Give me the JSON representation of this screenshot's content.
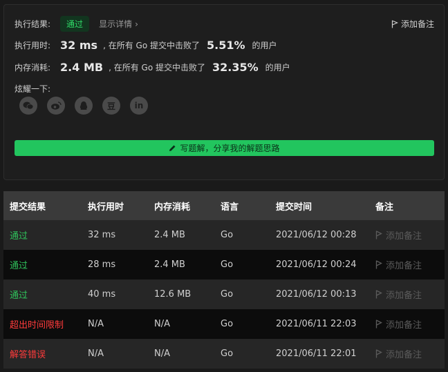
{
  "result": {
    "label": "执行结果:",
    "status": "通过",
    "details": "显示详情",
    "details_chevron": "›",
    "add_note": "添加备注"
  },
  "runtime": {
    "label": "执行用时:",
    "value": "32 ms",
    "prefix": ", 在所有 Go 提交中击败了",
    "percent": "5.51%",
    "suffix": "的用户"
  },
  "memory": {
    "label": "内存消耗:",
    "value": "2.4 MB",
    "prefix": ", 在所有 Go 提交中击败了",
    "percent": "32.35%",
    "suffix": "的用户"
  },
  "share": {
    "label": "炫耀一下:",
    "icons": [
      "wechat-icon",
      "weibo-icon",
      "qq-icon",
      "douban-icon",
      "linkedin-icon"
    ],
    "douban_glyph": "豆",
    "linkedin_glyph": "in"
  },
  "cta": {
    "label": "写题解，分享我的解题思路"
  },
  "table": {
    "headers": [
      "提交结果",
      "执行用时",
      "内存消耗",
      "语言",
      "提交时间",
      "备注"
    ],
    "rows": [
      {
        "result": "通过",
        "status": "ok",
        "time": "32 ms",
        "memory": "2.4 MB",
        "lang": "Go",
        "submitted": "2021/06/12 00:28",
        "note": "添加备注"
      },
      {
        "result": "通过",
        "status": "ok",
        "time": "28 ms",
        "memory": "2.4 MB",
        "lang": "Go",
        "submitted": "2021/06/12 00:24",
        "note": "添加备注"
      },
      {
        "result": "通过",
        "status": "ok",
        "time": "40 ms",
        "memory": "12.6 MB",
        "lang": "Go",
        "submitted": "2021/06/12 00:13",
        "note": "添加备注"
      },
      {
        "result": "超出时间限制",
        "status": "bad",
        "time": "N/A",
        "memory": "N/A",
        "lang": "Go",
        "submitted": "2021/06/11 22:03",
        "note": "添加备注"
      },
      {
        "result": "解答错误",
        "status": "bad",
        "time": "N/A",
        "memory": "N/A",
        "lang": "Go",
        "submitted": "2021/06/11 22:01",
        "note": "添加备注"
      }
    ]
  },
  "colors": {
    "accent": "#22c55e",
    "success": "#2fc25b",
    "error": "#ff3b3b"
  }
}
